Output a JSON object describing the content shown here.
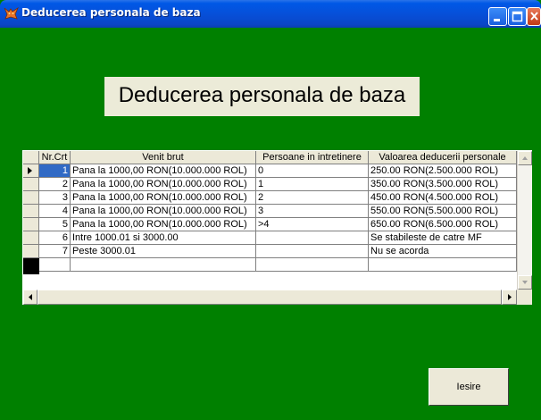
{
  "window": {
    "title": "Deducerea personala de baza"
  },
  "heading": "Deducerea personala de baza",
  "grid": {
    "columns": [
      "Nr.Crt",
      "Venit brut",
      "Persoane in intretinere",
      "Valoarea deducerii personale"
    ],
    "rows": [
      [
        "1",
        "Pana la 1000,00 RON(10.000.000 ROL)",
        "0",
        "250.00 RON(2.500.000 ROL)"
      ],
      [
        "2",
        "Pana la 1000,00 RON(10.000.000 ROL)",
        "1",
        "350.00 RON(3.500.000 ROL)"
      ],
      [
        "3",
        "Pana la 1000,00 RON(10.000.000 ROL)",
        "2",
        "450.00 RON(4.500.000 ROL)"
      ],
      [
        "4",
        "Pana la 1000,00 RON(10.000.000 ROL)",
        "3",
        "550.00 RON(5.500.000 ROL)"
      ],
      [
        "5",
        "Pana la 1000,00 RON(10.000.000 ROL)",
        ">4",
        "650.00 RON(6.500.000 ROL)"
      ],
      [
        "6",
        "Intre 1000.01 si 3000.00",
        "",
        "Se stabileste de catre MF"
      ],
      [
        "7",
        "Peste 3000.01",
        "",
        "Nu se acorda"
      ]
    ],
    "selected_row": 0
  },
  "buttons": {
    "exit": "Iesire"
  },
  "icons": {
    "app": "app-icon",
    "row_pointer": "row-pointer-icon"
  },
  "colors": {
    "background": "#008000",
    "selection": "#316ac5",
    "titlebar": "#0a46c8",
    "panel": "#ece9d8"
  }
}
